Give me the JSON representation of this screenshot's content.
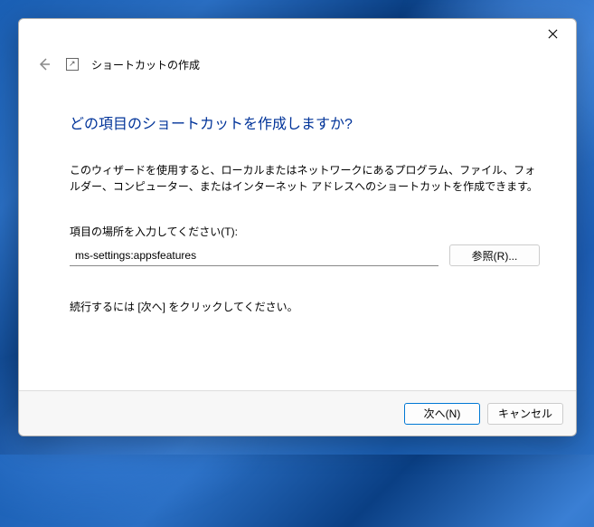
{
  "header": {
    "title": "ショートカットの作成"
  },
  "main": {
    "heading": "どの項目のショートカットを作成しますか?",
    "description": "このウィザードを使用すると、ローカルまたはネットワークにあるプログラム、ファイル、フォルダー、コンピューター、またはインターネット アドレスへのショートカットを作成できます。",
    "field_label": "項目の場所を入力してください(T):",
    "location_value": "ms-settings:appsfeatures",
    "browse_label": "参照(R)...",
    "instruction": "続行するには [次へ] をクリックしてください。"
  },
  "footer": {
    "next_label": "次へ(N)",
    "cancel_label": "キャンセル"
  }
}
